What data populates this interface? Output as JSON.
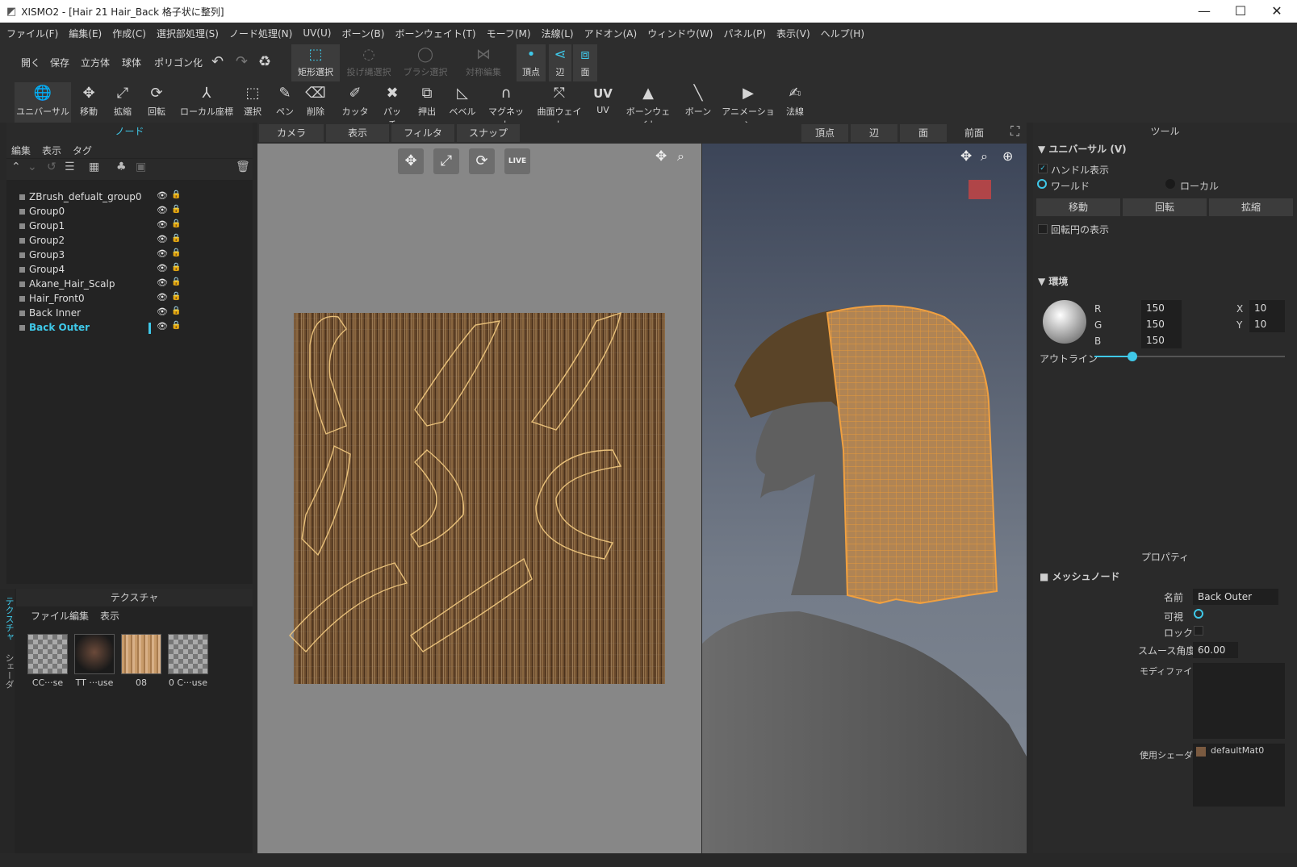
{
  "window": {
    "title": "XISMO2 - [Hair 21 Hair_Back 格子状に整列]",
    "min": "—",
    "max": "☐",
    "close": "✕"
  },
  "menu": [
    "ファイル(F)",
    "編集(E)",
    "作成(C)",
    "選択部処理(S)",
    "ノード処理(N)",
    "UV(U)",
    "ボーン(B)",
    "ボーンウェイト(T)",
    "モーフ(M)",
    "法線(L)",
    "アドオン(A)",
    "ウィンドウ(W)",
    "パネル(P)",
    "表示(V)",
    "ヘルプ(H)"
  ],
  "toolbar1": {
    "open": "開く",
    "save": "保存",
    "cube": "立方体",
    "sphere": "球体",
    "polygonize": "ポリゴン化",
    "undo": "↶",
    "redo": "↷",
    "recycle": "♻",
    "rect_select": "矩形選択",
    "lasso_select": "投げ縄選択",
    "brush_select": "ブラシ選択",
    "symmetric_edit": "対称編集",
    "vertex": "頂点",
    "edge": "辺",
    "face": "面"
  },
  "toolbar2": [
    {
      "icon": "🌐",
      "label": "ユニバーサル"
    },
    {
      "icon": "✥",
      "label": "移動"
    },
    {
      "icon": "⤢",
      "label": "拡縮"
    },
    {
      "icon": "⟳",
      "label": "回転"
    },
    {
      "icon": "⅄",
      "label": "ローカル座標"
    },
    {
      "icon": "⬚",
      "label": "選択"
    },
    {
      "icon": "✎",
      "label": "ペン"
    },
    {
      "icon": "⌫",
      "label": "削除"
    },
    {
      "icon": "✐",
      "label": "カッター"
    },
    {
      "icon": "✖",
      "label": "パッチ"
    },
    {
      "icon": "⧉",
      "label": "押出"
    },
    {
      "icon": "◺",
      "label": "ベベル"
    },
    {
      "icon": "∩",
      "label": "マグネット"
    },
    {
      "icon": "⤧",
      "label": "曲面ウェイト"
    },
    {
      "icon": "UV",
      "label": "UV"
    },
    {
      "icon": "▲",
      "label": "ボーンウェイト"
    },
    {
      "icon": "╲",
      "label": "ボーン"
    },
    {
      "icon": "▶",
      "label": "アニメーション"
    },
    {
      "icon": "✍",
      "label": "法線"
    }
  ],
  "node_panel": {
    "title": "ノード",
    "menu": [
      "編集",
      "表示",
      "タグ"
    ],
    "nodes": [
      "ZBrush_defualt_group0",
      "Group0",
      "Group1",
      "Group2",
      "Group3",
      "Group4",
      "Akane_Hair_Scalp",
      "Hair_Front0",
      "Back Inner",
      "Back Outer"
    ],
    "selected": "Back Outer"
  },
  "texture_panel": {
    "title": "テクスチャ",
    "menu": [
      "ファイル",
      "編集",
      "表示"
    ],
    "side_tabs": [
      "テクスチャ",
      "シェーダ"
    ],
    "thumbs": [
      "CC···se",
      "TT ···use",
      "08",
      "0 C···use"
    ]
  },
  "viewport_tabs": {
    "camera": "カメラ",
    "display": "表示",
    "filter": "フィルタ",
    "snap": "スナップ",
    "vertex": "頂点",
    "edge": "辺",
    "face": "面",
    "front": "前面"
  },
  "uv_nav": {
    "move": "✥",
    "scale": "⤢",
    "rotate": "⟳",
    "live": "LIVE"
  },
  "tool_panel": {
    "title": "ツール",
    "section": "ユニバーサル (V)",
    "handle_display": "ハンドル表示",
    "world": "ワールド",
    "local": "ローカル",
    "move": "移動",
    "rotate": "回転",
    "scale": "拡縮",
    "rot_circle": "回転円の表示",
    "env": "環境",
    "r_label": "R",
    "g_label": "G",
    "b_label": "B",
    "r": "150",
    "g": "150",
    "b": "150",
    "x_label": "X",
    "y_label": "Y",
    "x": "10",
    "y": "10",
    "outline": "アウトライン",
    "outline_level": 0.2
  },
  "property_panel": {
    "title": "プロパティ",
    "section": "メッシュノード",
    "name_label": "名前",
    "name": "Back Outer",
    "visible_label": "可視",
    "lock_label": "ロック",
    "smooth_label": "スムース角度",
    "smooth": "60.00",
    "modifier_label": "モディファイア",
    "shader_label": "使用シェーダ",
    "shader": "defaultMat0"
  },
  "colors": {
    "accent": "#3fc8e8",
    "wire": "#e89a3a",
    "panel": "#2a2a2a"
  }
}
